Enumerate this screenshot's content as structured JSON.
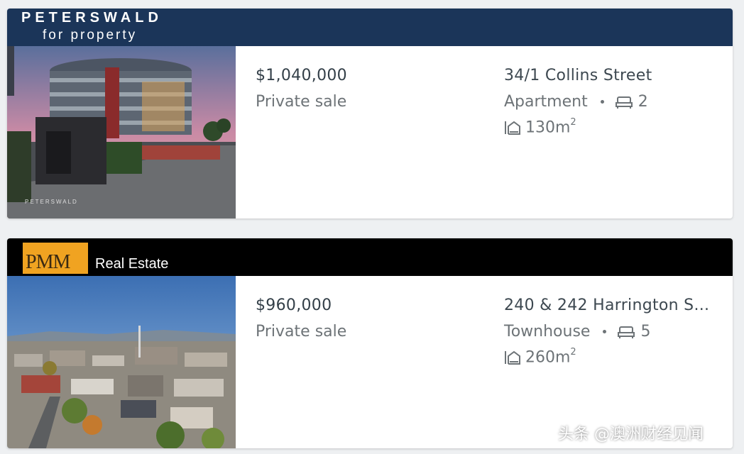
{
  "listings": [
    {
      "agency": {
        "line1": "PETERSWALD",
        "line2": "for property",
        "bar_color": "#1b3559"
      },
      "price": "$1,040,000",
      "sale_method": "Private sale",
      "address": "34/1 Collins Street",
      "property_type": "Apartment",
      "bedrooms": "2",
      "size": "130m",
      "size_unit_sup": "2",
      "photo": {
        "icon": "apartment-building-photo"
      }
    },
    {
      "agency": {
        "logo_text": "PMM",
        "name": "Real Estate",
        "bar_color": "#000000",
        "logo_color": "#f0a321"
      },
      "price": "$960,000",
      "sale_method": "Private sale",
      "address": "240 & 242 Harrington S...",
      "property_type": "Townhouse",
      "bedrooms": "5",
      "size": "260m",
      "size_unit_sup": "2",
      "photo": {
        "icon": "city-aerial-photo"
      }
    }
  ],
  "watermark": "头条 @澳洲财经见闻"
}
